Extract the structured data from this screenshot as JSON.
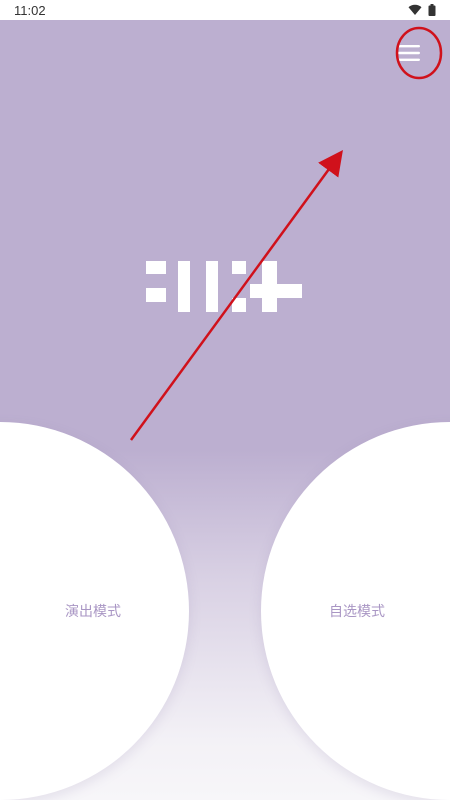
{
  "status_bar": {
    "time": "11:02",
    "icons": [
      "wifi-icon",
      "battery-icon"
    ]
  },
  "header": {
    "menu_icon": "hamburger-menu-icon"
  },
  "logo": {
    "name": "app-logo"
  },
  "modes": {
    "performance_label": "演出模式",
    "custom_label": "自选模式"
  },
  "annotation": {
    "arrow_color": "#d0111b",
    "highlight_color": "#d0111b"
  },
  "colors": {
    "background": "#bcafd0",
    "label": "#a996c4"
  }
}
